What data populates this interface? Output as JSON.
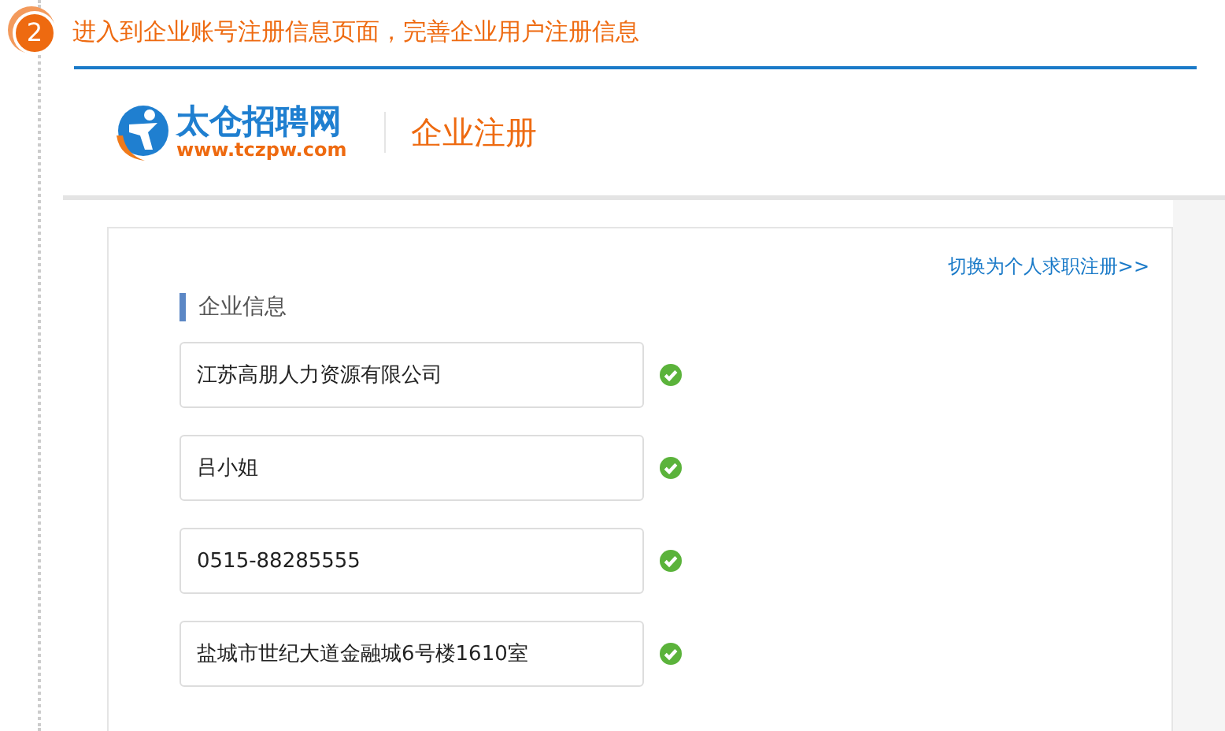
{
  "step": {
    "number": "2",
    "title": "进入到企业账号注册信息页面，完善企业用户注册信息"
  },
  "header": {
    "logo_name": "太仓招聘网",
    "logo_url": "www.tczpw.com",
    "page_title": "企业注册"
  },
  "form": {
    "switch_link": "切换为个人求职注册>>",
    "section_title": "企业信息",
    "fields": [
      {
        "value": "江苏高朋人力资源有限公司",
        "valid": true
      },
      {
        "value": "吕小姐",
        "valid": true
      },
      {
        "value": "0515-88285555",
        "valid": true
      },
      {
        "value": "盐城市世纪大道金融城6号楼1610室",
        "valid": true
      }
    ]
  }
}
